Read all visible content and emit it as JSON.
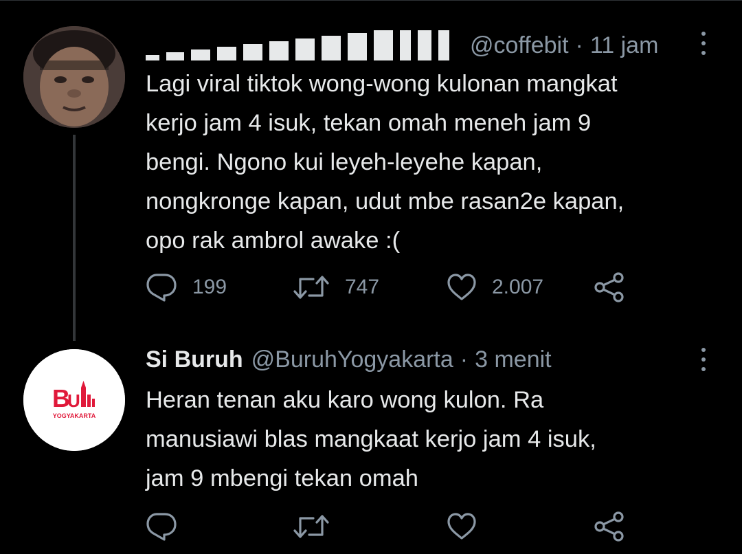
{
  "tweets": [
    {
      "display_name": "",
      "handle": "@coffebit",
      "separator": "·",
      "time": "11 jam",
      "text": "Lagi viral tiktok wong-wong kulonan mangkat\nkerjo jam 4 isuk, tekan omah meneh jam 9\nbengi. Ngono kui leyeh-leyehe kapan,\nnongkronge kapan, udut mbe rasan2e kapan,\nopo rak ambrol awake :(",
      "replies": "199",
      "retweets": "747",
      "likes": "2.007"
    },
    {
      "display_name": "Si Buruh",
      "handle": "@BuruhYogyakarta",
      "separator": "·",
      "time": "3 menit",
      "text": "Heran tenan aku karo wong kulon. Ra\nmanusiawi blas mangkaat kerjo jam 4 isuk,\njam 9 mbengi tekan omah",
      "replies": "",
      "retweets": "",
      "likes": "",
      "avatar_logo_text": "Buruh YOGYAKARTA",
      "avatar_logo_color": "#e0193a"
    }
  ],
  "icons": {
    "reply": "reply-icon",
    "retweet": "retweet-icon",
    "like": "like-icon",
    "share": "share-icon",
    "more": "more-icon"
  },
  "colors": {
    "background": "#000000",
    "text": "#e7e9ea",
    "secondary": "#8b98a5",
    "thread_line": "#333639"
  }
}
